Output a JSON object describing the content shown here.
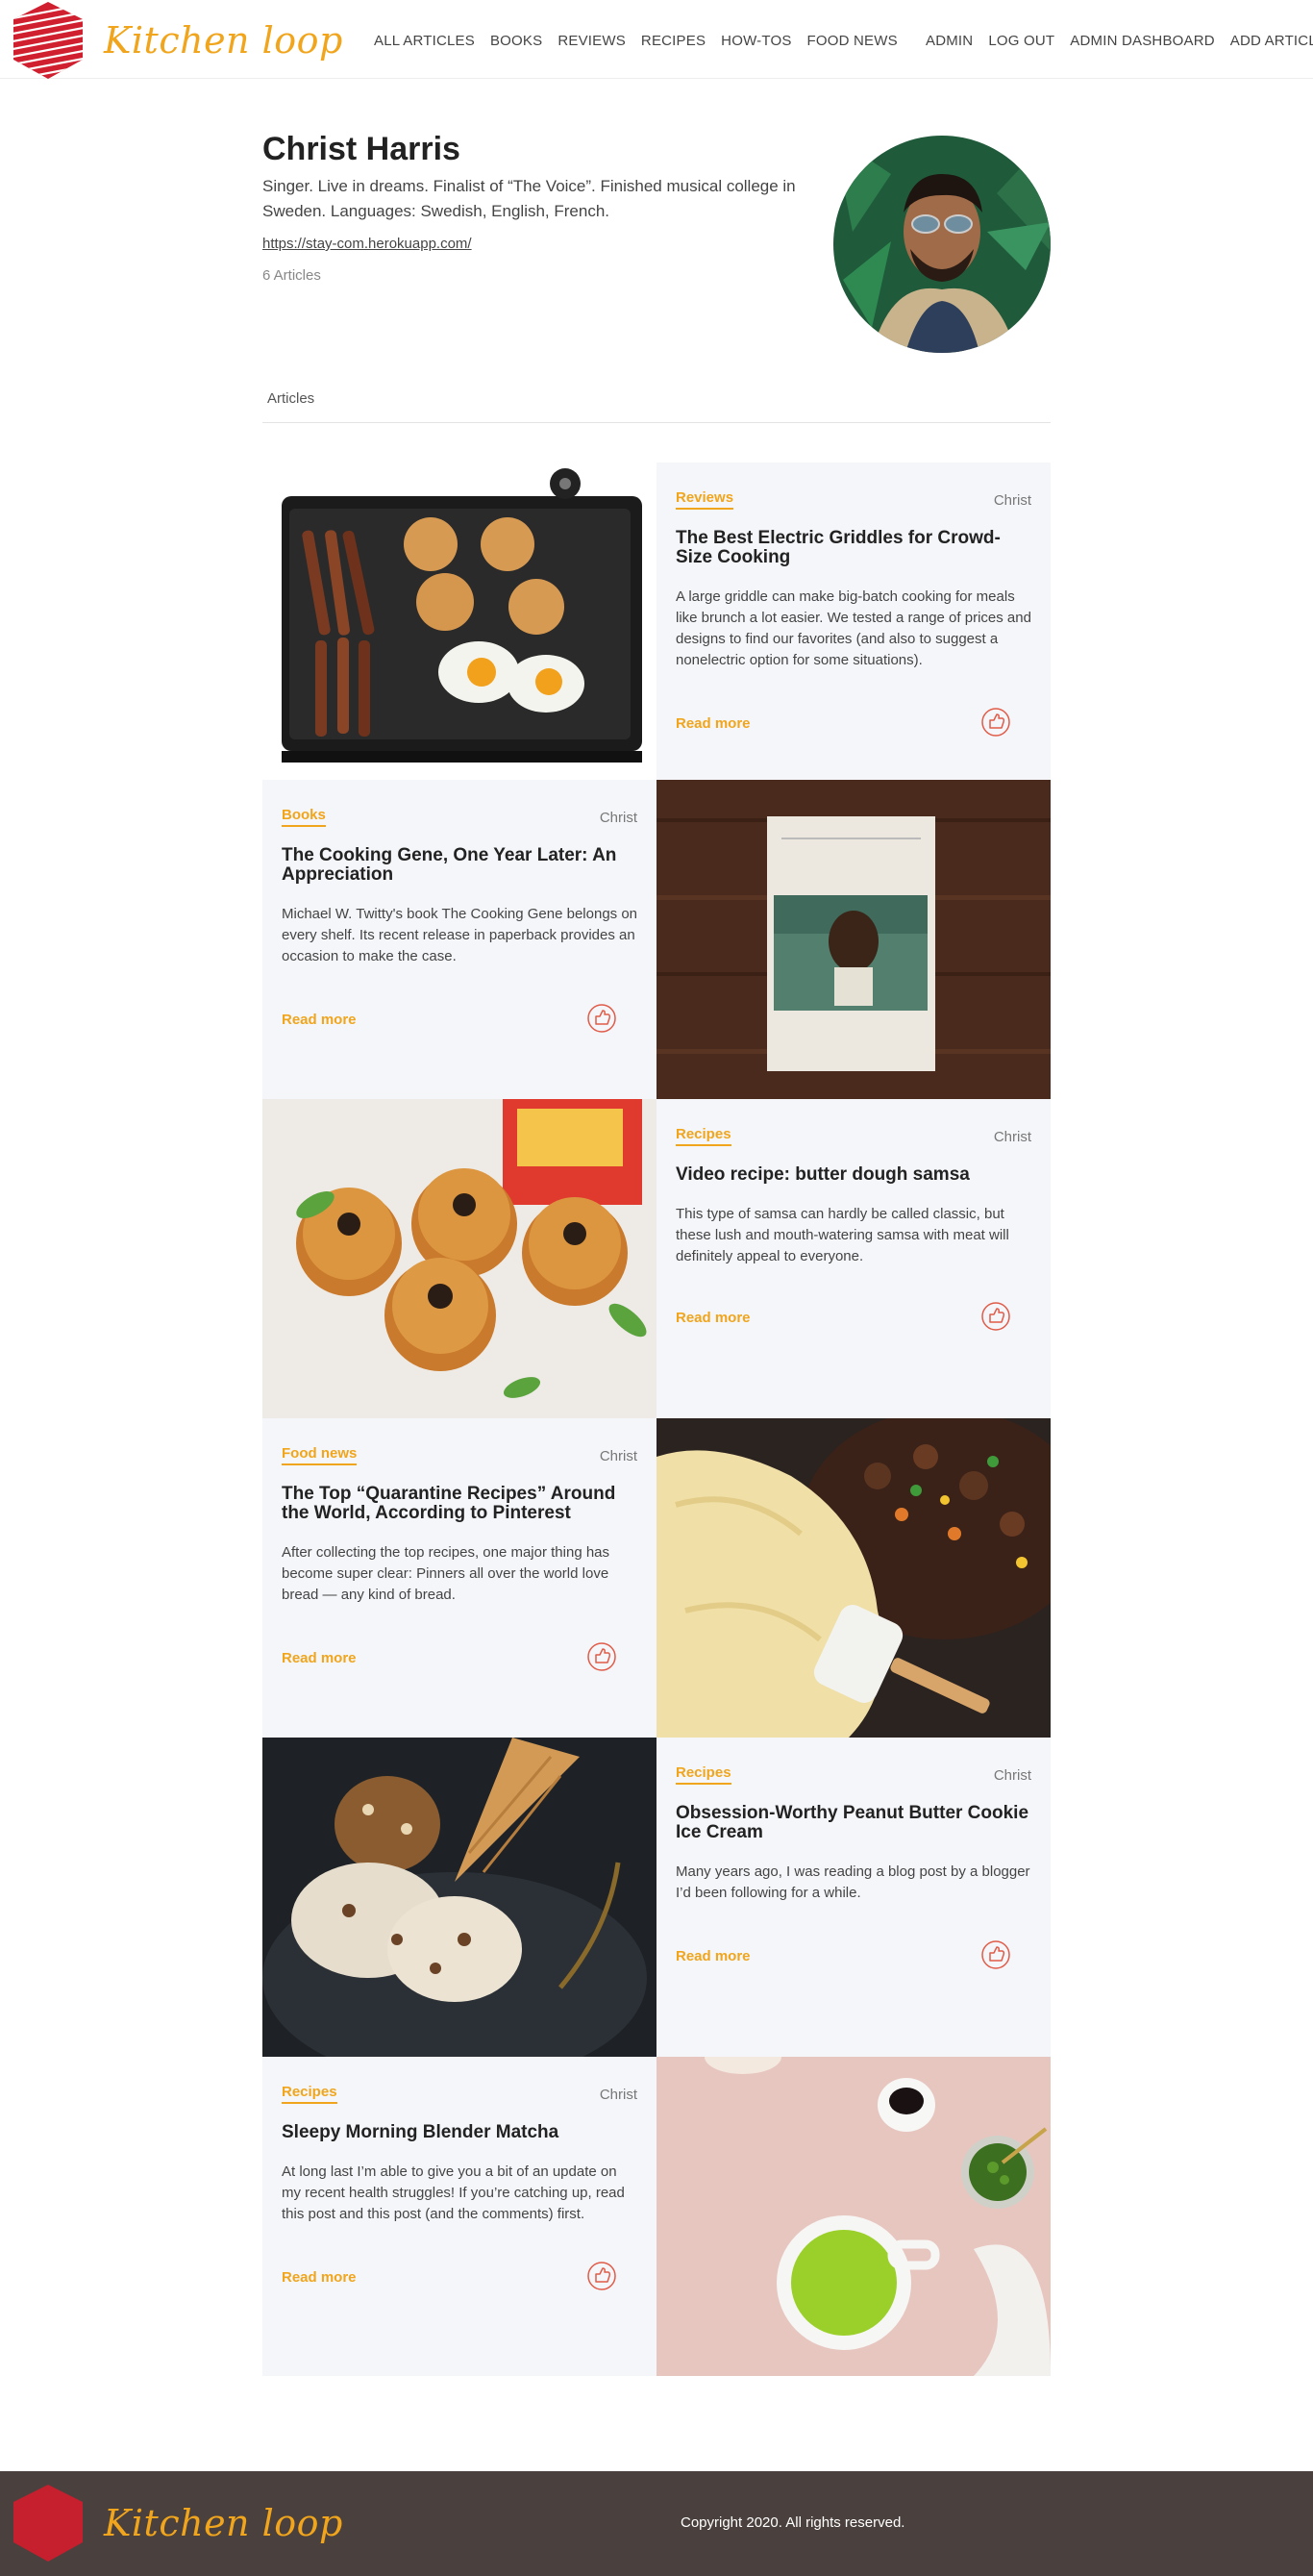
{
  "brand": {
    "name": "Kitchen loop",
    "color": "#f0a51c"
  },
  "nav": {
    "left": [
      "ALL ARTICLES",
      "BOOKS",
      "REVIEWS",
      "RECIPES",
      "HOW-TOS",
      "FOOD NEWS"
    ],
    "right": [
      "ADMIN",
      "LOG OUT",
      "ADMIN DASHBOARD",
      "ADD ARTICLE"
    ]
  },
  "profile": {
    "name": "Christ Harris",
    "bio": "Singer. Live in dreams. Finalist of “The Voice”. Finished musical college in Sweden. Languages: Swedish, English, French.",
    "link": "https://stay-com.herokuapp.com/",
    "article_count": "6 Articles"
  },
  "tabs": {
    "articles": "Articles"
  },
  "articles": [
    {
      "category": "Reviews",
      "author": "Christ",
      "title": "The Best Electric Griddles for Crowd-Size Cooking",
      "excerpt": "A large griddle can make big-batch cooking for meals like brunch a lot easier. We tested a range of prices and designs to find our favorites (and also to suggest a nonelectric option for some situations).",
      "read_more": "Read more",
      "image": "electric-griddle-photo"
    },
    {
      "category": "Books",
      "author": "Christ",
      "title": "The Cooking Gene, One Year Later: An Appreciation",
      "excerpt": "Michael W. Twitty's book The Cooking Gene belongs on every shelf. Its recent release in paperback provides an occasion to make the case.",
      "read_more": "Read more",
      "image": "cooking-gene-book-photo"
    },
    {
      "category": "Recipes",
      "author": "Christ",
      "title": "Video recipe: butter dough samsa",
      "excerpt": "This type of samsa can hardly be called classic, but these lush and mouth-watering samsa with meat will definitely appeal to everyone.",
      "read_more": "Read more",
      "image": "samsa-buns-photo"
    },
    {
      "category": "Food news",
      "author": "Christ",
      "title": "The Top “Quarantine Recipes” Around the World, According to Pinterest",
      "excerpt": "After collecting the top recipes, one major thing has become super clear: Pinners all over the world love bread — any kind of bread.",
      "read_more": "Read more",
      "image": "mashed-potato-pie-photo"
    },
    {
      "category": "Recipes",
      "author": "Christ",
      "title": "Obsession-Worthy Peanut Butter Cookie Ice Cream",
      "excerpt": "Many years ago, I was reading a blog post by a blogger I’d been following for a while.",
      "read_more": "Read more",
      "image": "ice-cream-cone-photo"
    },
    {
      "category": "Recipes",
      "author": "Christ",
      "title": "Sleepy Morning Blender Matcha",
      "excerpt": "At long last I’m able to give you a bit of an update on my recent health struggles! If you’re catching up, read this post and this post (and the comments) first.",
      "read_more": "Read more",
      "image": "matcha-drink-photo"
    }
  ],
  "footer": {
    "brand": "Kitchen loop",
    "copyright": "Copyright 2020. All rights reserved."
  }
}
